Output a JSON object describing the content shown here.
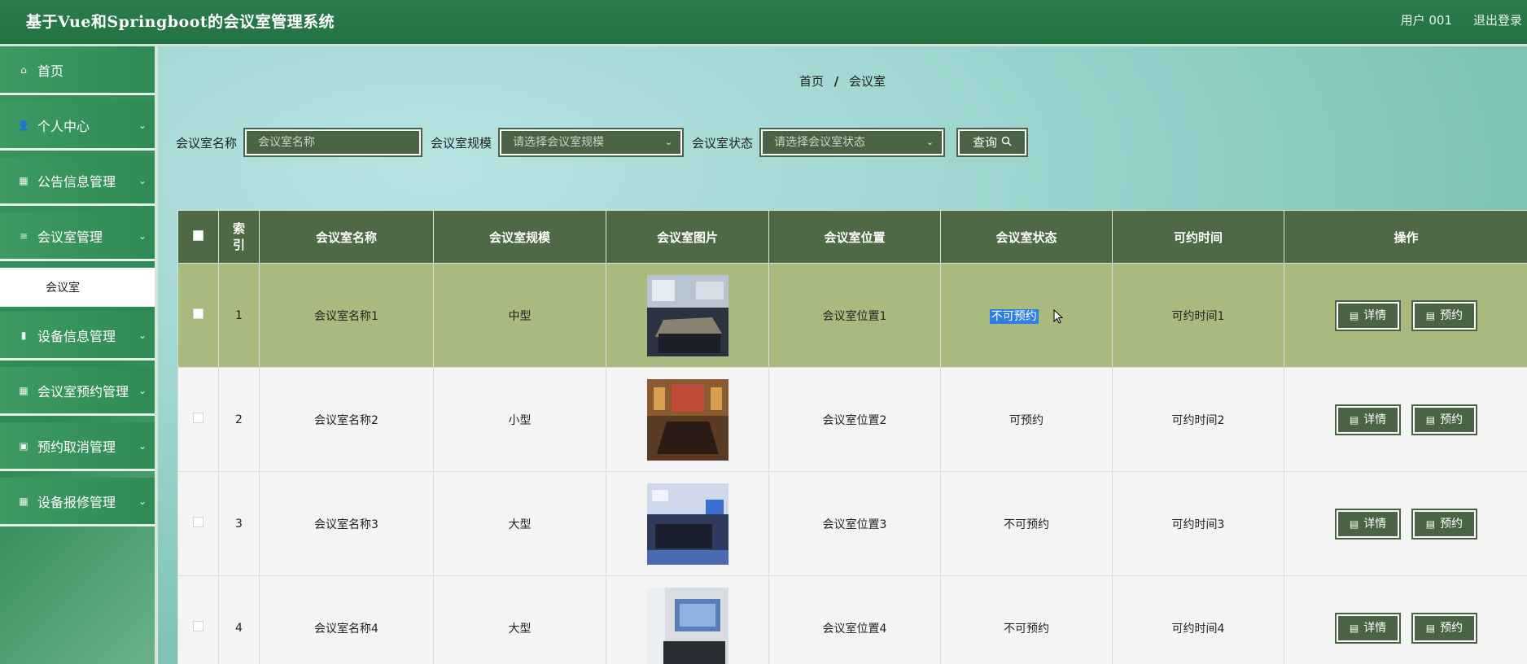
{
  "header": {
    "title": "基于Vue和Springboot的会议室管理系统",
    "user": "用户 001",
    "logout": "退出登录"
  },
  "sidebar": {
    "items": [
      {
        "label": "首页",
        "icon": "home-icon",
        "glyph": "⌂",
        "chevron": false
      },
      {
        "label": "个人中心",
        "icon": "user-icon",
        "glyph": "👤",
        "chevron": true
      },
      {
        "label": "公告信息管理",
        "icon": "grid-icon",
        "glyph": "▦",
        "chevron": true
      },
      {
        "label": "会议室管理",
        "icon": "menu-icon",
        "glyph": "≡",
        "chevron": true
      },
      {
        "label": "设备信息管理",
        "icon": "bars-icon",
        "glyph": "▮",
        "chevron": true
      },
      {
        "label": "会议室预约管理",
        "icon": "grid-icon",
        "glyph": "▦",
        "chevron": true
      },
      {
        "label": "预约取消管理",
        "icon": "clipboard-icon",
        "glyph": "▣",
        "chevron": true
      },
      {
        "label": "设备报修管理",
        "icon": "grid-icon",
        "glyph": "▦",
        "chevron": true
      }
    ],
    "submenu": {
      "label": "会议室"
    }
  },
  "breadcrumb": {
    "home": "首页",
    "sep": "/",
    "current": "会议室"
  },
  "filters": {
    "name_label": "会议室名称",
    "name_placeholder": "会议室名称",
    "scale_label": "会议室规模",
    "scale_placeholder": "请选择会议室规模",
    "status_label": "会议室状态",
    "status_placeholder": "请选择会议室状态",
    "search_label": "查询"
  },
  "table": {
    "headers": [
      "",
      "索引",
      "会议室名称",
      "会议室规模",
      "会议室图片",
      "会议室位置",
      "会议室状态",
      "可约时间",
      "操作"
    ],
    "rows": [
      {
        "index": "1",
        "name": "会议室名称1",
        "scale": "中型",
        "location": "会议室位置1",
        "status": "不可预约",
        "time": "可约时间1"
      },
      {
        "index": "2",
        "name": "会议室名称2",
        "scale": "小型",
        "location": "会议室位置2",
        "status": "可预约",
        "time": "可约时间2"
      },
      {
        "index": "3",
        "name": "会议室名称3",
        "scale": "大型",
        "location": "会议室位置3",
        "status": "不可预约",
        "time": "可约时间3"
      },
      {
        "index": "4",
        "name": "会议室名称4",
        "scale": "大型",
        "location": "会议室位置4",
        "status": "不可预约",
        "time": "可约时间4"
      }
    ],
    "actions": {
      "detail": "详情",
      "reserve": "预约"
    }
  },
  "colors": {
    "header_green": "#227243",
    "dark_olive": "#4a6344",
    "row_highlight": "#a9ba7f",
    "selection_blue": "#2f7ee6"
  }
}
